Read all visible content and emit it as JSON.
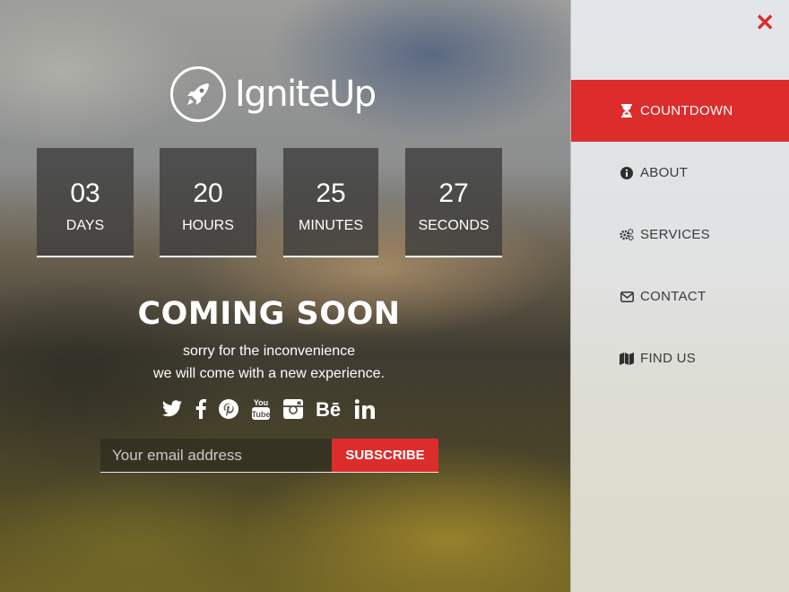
{
  "brand": {
    "name": "IgniteUp",
    "icon": "rocket-icon"
  },
  "countdown": [
    {
      "value": "03",
      "label": "DAYS"
    },
    {
      "value": "20",
      "label": "HOURS"
    },
    {
      "value": "25",
      "label": "MINUTES"
    },
    {
      "value": "27",
      "label": "SECONDS"
    }
  ],
  "heading": "COMING SOON",
  "subtitle": [
    "sorry for the inconvenience",
    "we will come with a new experience."
  ],
  "social": [
    "twitter-icon",
    "facebook-icon",
    "pinterest-icon",
    "youtube-icon",
    "instagram-icon",
    "behance-icon",
    "linkedin-icon"
  ],
  "subscribe": {
    "placeholder": "Your email address",
    "button_label": "SUBSCRIBE"
  },
  "menu": {
    "close_icon": "close-icon",
    "items": [
      {
        "label": "COUNTDOWN",
        "icon": "hourglass-icon",
        "active": true
      },
      {
        "label": "ABOUT",
        "icon": "info-icon",
        "active": false
      },
      {
        "label": "SERVICES",
        "icon": "gears-icon",
        "active": false
      },
      {
        "label": "CONTACT",
        "icon": "envelope-icon",
        "active": false
      },
      {
        "label": "FIND US",
        "icon": "map-icon",
        "active": false
      }
    ]
  },
  "colors": {
    "accent": "#dd2c2c",
    "sidebar_bg": "#e1e4e6",
    "timer_bg": "#40403e"
  }
}
